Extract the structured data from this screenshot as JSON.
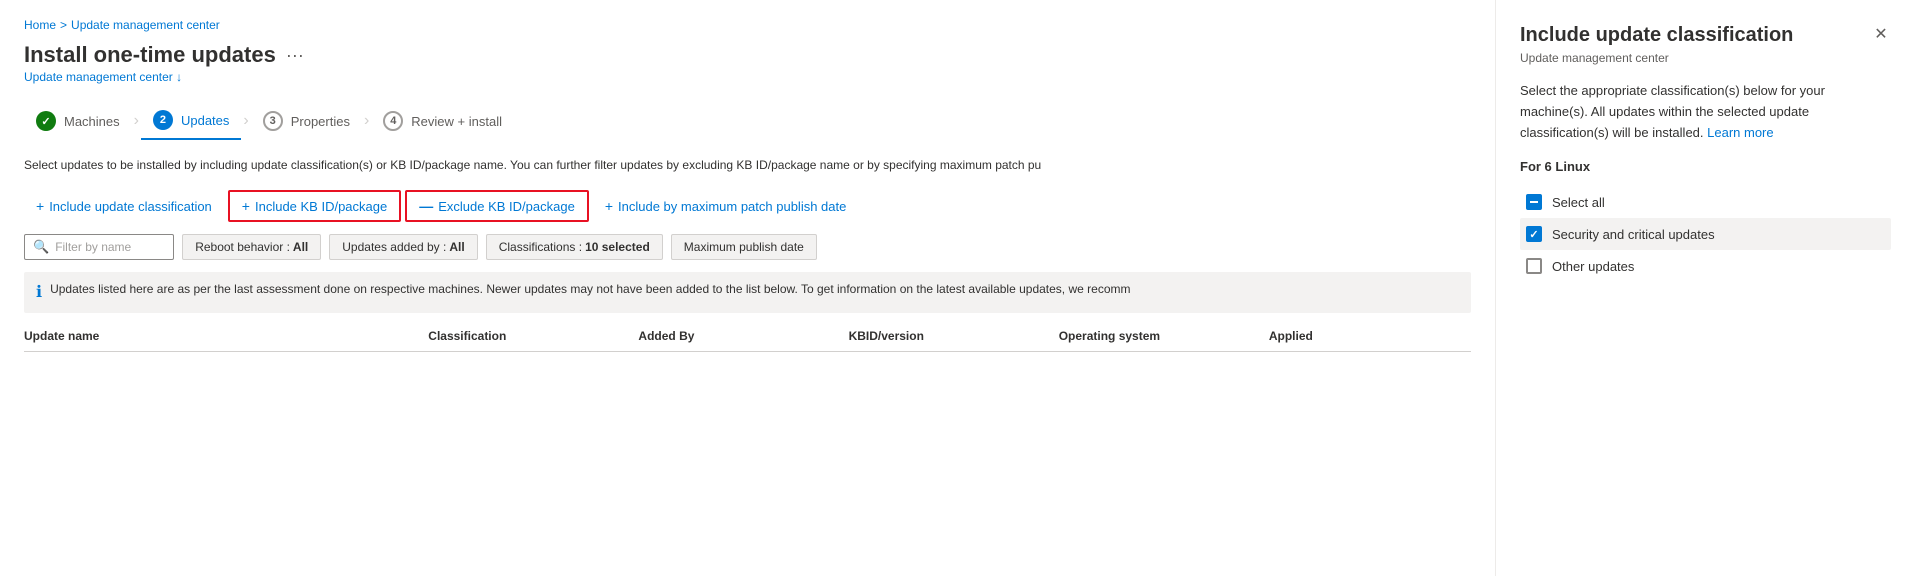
{
  "breadcrumb": {
    "home": "Home",
    "separator1": ">",
    "updateCenter": "Update management center"
  },
  "page": {
    "title": "Install one-time updates",
    "menu_icon": "···",
    "subtitle": "Update management center ↓"
  },
  "wizard": {
    "steps": [
      {
        "id": "machines",
        "label": "Machines",
        "state": "done",
        "icon": "✓"
      },
      {
        "id": "updates",
        "label": "Updates",
        "state": "active",
        "icon": "2"
      },
      {
        "id": "properties",
        "label": "Properties",
        "state": "pending",
        "icon": "3"
      },
      {
        "id": "review",
        "label": "Review + install",
        "state": "pending",
        "icon": "4"
      }
    ]
  },
  "info_text": "Select updates to be installed by including update classification(s) or KB ID/package name. You can further filter updates by excluding KB ID/package name or by specifying maximum patch pu",
  "toolbar": {
    "include_classification": "+ Include update classification",
    "include_kb": "+ Include KB ID/package",
    "exclude_kb": "— Exclude KB ID/package",
    "include_date": "+ Include by maximum patch publish date"
  },
  "filters": {
    "search_placeholder": "Filter by name",
    "reboot": "Reboot behavior : All",
    "updates_added": "Updates added by : All",
    "classifications": "Classifications : 10 selected",
    "max_publish": "Maximum publish date"
  },
  "info_banner": "Updates listed here are as per the last assessment done on respective machines. Newer updates may not have been added to the list below. To get information on the latest available updates, we recomm",
  "table": {
    "columns": [
      "Update name",
      "Classification",
      "Added By",
      "KBID/version",
      "Operating system",
      "Applied"
    ]
  },
  "panel": {
    "title": "Include update classification",
    "subtitle": "Update management center",
    "description": "Select the appropriate classification(s) below for your machine(s). All updates within the selected update classification(s) will be installed.",
    "learn_more": "Learn more",
    "section_label": "For 6 Linux",
    "close_icon": "✕",
    "checkboxes": [
      {
        "id": "select_all",
        "label": "Select all",
        "state": "indeterminate"
      },
      {
        "id": "security_critical",
        "label": "Security and critical updates",
        "state": "checked",
        "highlighted": true
      },
      {
        "id": "other_updates",
        "label": "Other updates",
        "state": "unchecked"
      }
    ]
  }
}
